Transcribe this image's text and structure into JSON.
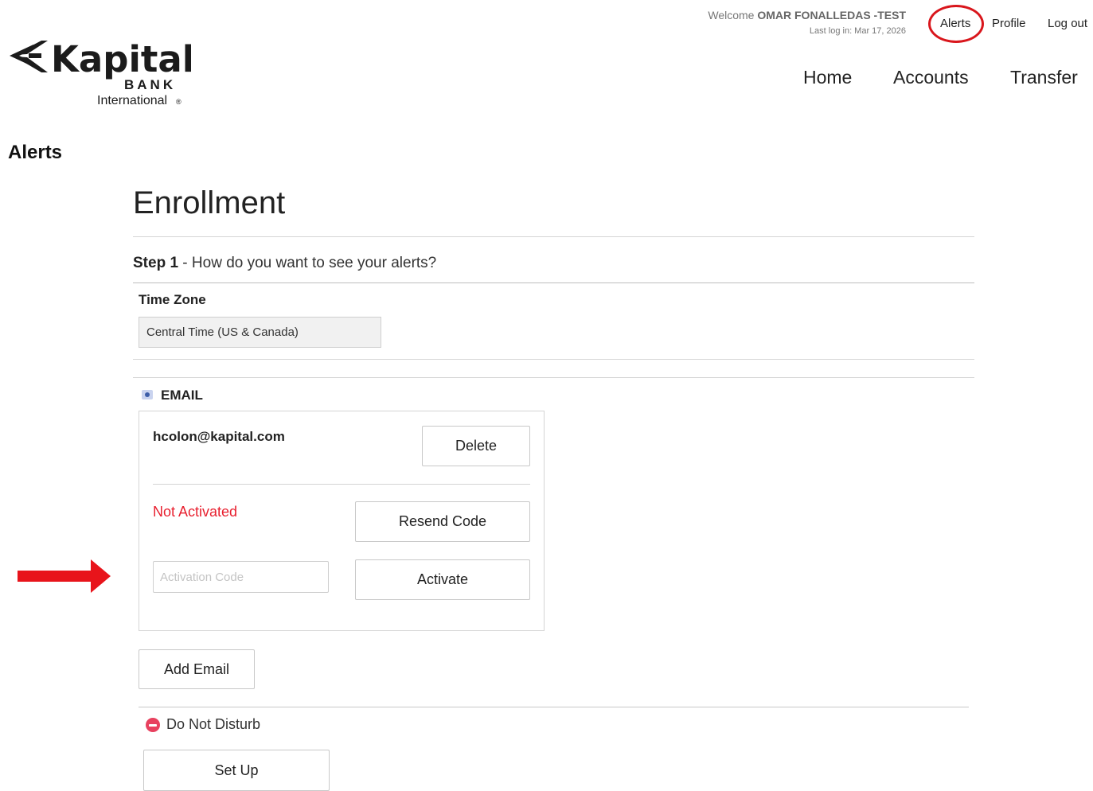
{
  "brand": {
    "name": "Kapital",
    "sub": "BANK",
    "tagline": "International",
    "mark": "®"
  },
  "header": {
    "welcome_prefix": "Welcome",
    "user_name": "OMAR FONALLEDAS -TEST",
    "last_login": "Last log in: Mar 17, 2026",
    "links": {
      "alerts": "Alerts",
      "profile": "Profile",
      "logout": "Log out"
    }
  },
  "nav": {
    "home": "Home",
    "accounts": "Accounts",
    "transfer": "Transfer"
  },
  "page": {
    "heading": "Alerts"
  },
  "enrollment": {
    "title": "Enrollment",
    "step_number": "Step 1",
    "step_text": " - How do you want to see your alerts?",
    "timezone_label": "Time Zone",
    "timezone_value": "Central Time (US & Canada)",
    "email_section_label": "EMAIL",
    "email_address": "hcolon@kapital.com",
    "delete_label": "Delete",
    "status_text": "Not Activated",
    "resend_label": "Resend Code",
    "activation_placeholder": "Activation Code",
    "activate_label": "Activate",
    "add_email_label": "Add Email",
    "dnd_label": "Do Not Disturb",
    "setup_label": "Set Up"
  },
  "colors": {
    "accent_red": "#d9161c",
    "status_red": "#e8202f",
    "dnd_icon": "#e8415f",
    "email_icon": "#3d5ea8"
  },
  "icons": [
    "kapital-logo-icon",
    "email-icon",
    "do-not-disturb-icon",
    "arrow-right-icon"
  ]
}
